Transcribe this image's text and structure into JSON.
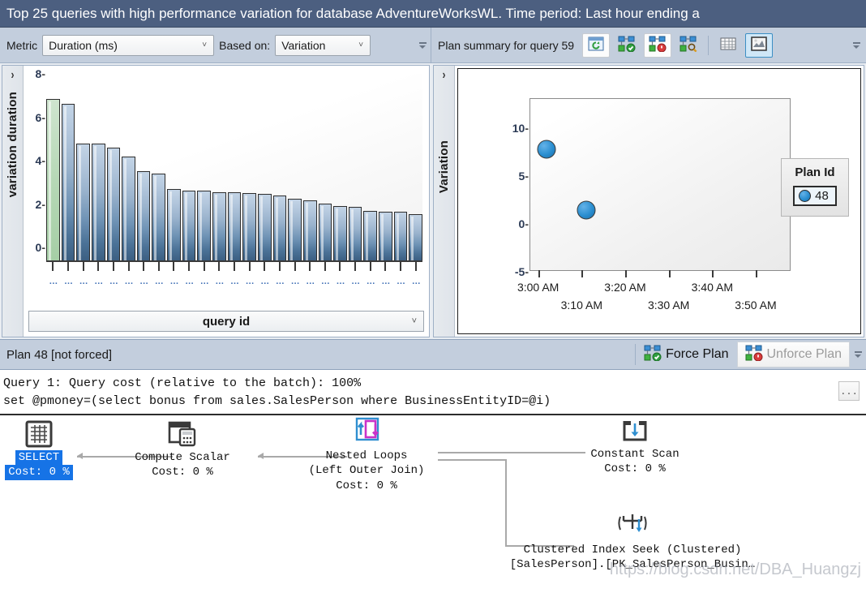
{
  "title_bar": {
    "text": "Top 25 queries with high performance variation for database AdventureWorksWL. Time period: Last hour ending a"
  },
  "toolbar": {
    "metric_label": "Metric",
    "metric_value": "Duration (ms)",
    "based_on_label": "Based on:",
    "based_on_value": "Variation",
    "plan_summary_label": "Plan summary for query 59",
    "chevron": "˅",
    "buttons": [
      {
        "name": "refresh-plan-summary-icon",
        "title": "Refresh"
      },
      {
        "name": "force-plan-icon",
        "title": "Force Plan"
      },
      {
        "name": "unforce-plan-icon",
        "title": "Unforce Plan"
      },
      {
        "name": "compare-plans-icon",
        "title": "Compare Plans"
      },
      {
        "name": "grid-view-icon",
        "title": "Grid view"
      },
      {
        "name": "chart-view-icon",
        "title": "Chart view"
      }
    ]
  },
  "left_chart": {
    "y_axis_label": "variation duration",
    "x_axis_label": "query id",
    "collapse_arrow": "›"
  },
  "right_chart": {
    "y_axis_label": "Variation",
    "collapse_arrow": "›",
    "legend_title": "Plan Id",
    "legend_items": [
      "48"
    ]
  },
  "plan_bar": {
    "label": "Plan 48 [not forced]",
    "force_plan_label": "Force Plan",
    "unforce_plan_label": "Unforce Plan"
  },
  "query_text": {
    "line1": "Query 1: Query cost (relative to the batch): 100%",
    "line2": "set @pmoney=(select bonus from sales.SalesPerson where BusinessEntityID=@i)",
    "ellipsis_button": "..."
  },
  "plan_nodes": [
    {
      "id": "select",
      "line1": "SELECT",
      "line2": "Cost: 0 %",
      "line3": ""
    },
    {
      "id": "compute",
      "line1": "Compute Scalar",
      "line2": "Cost: 0 %",
      "line3": ""
    },
    {
      "id": "nested",
      "line1": "Nested Loops",
      "line2": "(Left Outer Join)",
      "line3": "Cost: 0 %"
    },
    {
      "id": "constant",
      "line1": "Constant Scan",
      "line2": "Cost: 0 %",
      "line3": ""
    },
    {
      "id": "seek",
      "line1": "Clustered Index Seek (Clustered)",
      "line2": "[SalesPerson].[PK_SalesPerson_Busin…",
      "line3": ""
    }
  ],
  "watermark": "https://blog.csdn.net/DBA_Huangzj",
  "colors": {
    "title_bar_bg": "#4c5f80",
    "toolbar_bg": "#c3cedd",
    "bar_fill": "#6f93b5",
    "bar_selected_fill": "#b6d8b6",
    "dot_fill": "#2a8ed0",
    "select_node_highlight": "#1673e6",
    "tick_label": "#3f6fb5"
  },
  "chart_data": [
    {
      "type": "bar",
      "title": "",
      "xlabel": "query id",
      "ylabel": "variation duration",
      "ylim": [
        0,
        8.6
      ],
      "yticks": [
        0,
        2,
        4,
        6,
        8
      ],
      "grid": false,
      "categories": [
        "…",
        "…",
        "…",
        "…",
        "…",
        "…",
        "…",
        "…",
        "…",
        "…",
        "…",
        "…",
        "…",
        "…",
        "…",
        "…",
        "…",
        "…",
        "…",
        "…",
        "…",
        "…",
        "…",
        "…",
        "…"
      ],
      "values": [
        7.45,
        7.2,
        5.4,
        5.4,
        5.2,
        4.8,
        4.1,
        4.0,
        3.3,
        3.2,
        3.2,
        3.15,
        3.15,
        3.1,
        3.05,
        3.0,
        2.85,
        2.75,
        2.6,
        2.5,
        2.45,
        2.3,
        2.25,
        2.25,
        2.15
      ],
      "selected_index": 0
    },
    {
      "type": "scatter",
      "title": "",
      "xlabel": "",
      "ylabel": "Variation",
      "ylim": [
        -5,
        13
      ],
      "yticks": [
        -5,
        0,
        5,
        10
      ],
      "xticks": [
        "3:00 AM",
        "3:10 AM",
        "3:20 AM",
        "3:30 AM",
        "3:40 AM",
        "3:50 AM"
      ],
      "grid": false,
      "legend_position": "right",
      "series": [
        {
          "name": "48",
          "points": [
            {
              "x": "3:02 AM",
              "y": 7.8
            },
            {
              "x": "3:11 AM",
              "y": 1.4
            }
          ]
        }
      ]
    }
  ]
}
